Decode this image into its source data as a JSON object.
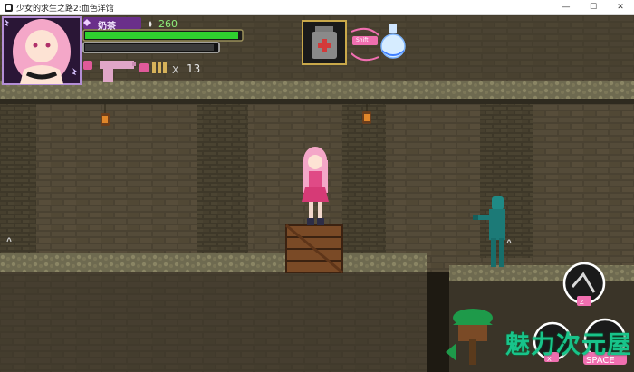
{
  "window": {
    "title": "少女的求生之路2:血色洋馆",
    "minimize_glyph": "—",
    "maximize_glyph": "☐",
    "close_glyph": "✕"
  },
  "hud": {
    "character_name": "奶茶",
    "resource_count": "260",
    "health_fraction": 0.98,
    "stamina_fraction": 0.97,
    "ammo_count": "13",
    "ammo_multiplier": "X",
    "item_swap_key": "Shift"
  },
  "controls": {
    "attack_key": "Z",
    "interact_key": "X",
    "jump_key": "SPACE"
  },
  "watermark": {
    "text": "魅力次元屋"
  },
  "colors": {
    "health": "#2fd12f",
    "stamina": "#3a3a3a",
    "hud_panel": "#6a2f8a",
    "brick": "#4e4635",
    "stone": "#7a7458",
    "enemy": "#1f8a86",
    "watermark": "#18c48a"
  },
  "icons": [
    "pistol-icon",
    "bullet-icon",
    "heart-badge-icon",
    "potion-flask-icon",
    "medkit-icon",
    "swap-arrows-icon",
    "lantern-icon",
    "treehouse-logo-icon"
  ]
}
